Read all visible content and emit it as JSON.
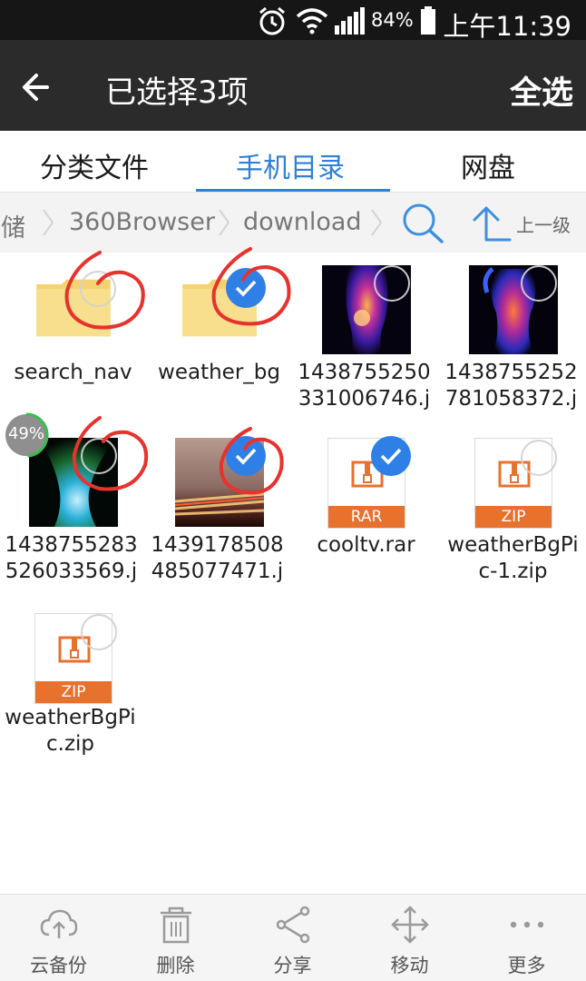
{
  "status_bar": {
    "battery_percent": "84%",
    "time": "上午11:39",
    "icons": [
      "alarm-icon",
      "wifi-icon",
      "signal-icon",
      "battery-icon"
    ]
  },
  "header": {
    "title": "已选择3项",
    "select_all": "全选",
    "back_icon": "back-arrow-icon"
  },
  "tabs": [
    {
      "label": "分类文件",
      "active": false
    },
    {
      "label": "手机目录",
      "active": true
    },
    {
      "label": "网盘",
      "active": false
    }
  ],
  "breadcrumb": {
    "items": [
      "存储",
      "360Browser",
      "download"
    ],
    "up_label": "上一级",
    "search_icon": "search-icon",
    "up_icon": "up-arrow-icon"
  },
  "files": [
    {
      "name": "search_nav",
      "type": "folder",
      "selected": false
    },
    {
      "name": "weather_bg",
      "type": "folder",
      "selected": true
    },
    {
      "name": "1438755250331006746.j",
      "line1": "1438755250",
      "line2": "331006746.j",
      "type": "image",
      "selected": false
    },
    {
      "name": "1438755252781058372.j",
      "line1": "1438755252",
      "line2": "781058372.j",
      "type": "image",
      "selected": false
    },
    {
      "name": "1438755283526033569.j",
      "line1": "1438755283",
      "line2": "526033569.j",
      "type": "image",
      "selected": false
    },
    {
      "name": "1439178508485077471.j",
      "line1": "1439178508",
      "line2": "485077471.j",
      "type": "image",
      "selected": true
    },
    {
      "name": "cooltv.rar",
      "type": "archive",
      "badge": "RAR",
      "selected": true
    },
    {
      "name": "weatherBgPic-1.zip",
      "line1": "weatherBgPi",
      "line2": "c-1.zip",
      "type": "archive",
      "badge": "ZIP",
      "selected": false
    },
    {
      "name": "weatherBgPic.zip",
      "line1": "weatherBgPi",
      "line2": "c.zip",
      "type": "archive",
      "badge": "ZIP",
      "selected": false
    }
  ],
  "progress": {
    "label": "49%",
    "value": 0.49
  },
  "toolbar": [
    {
      "label": "云备份",
      "icon": "cloud-upload-icon"
    },
    {
      "label": "删除",
      "icon": "trash-icon"
    },
    {
      "label": "分享",
      "icon": "share-icon"
    },
    {
      "label": "移动",
      "icon": "move-icon"
    },
    {
      "label": "更多",
      "icon": "more-icon"
    }
  ],
  "colors": {
    "accent": "#2f80d6",
    "check": "#2f80e6",
    "archive_badge": "#e8712e",
    "annotation": "#e8322d",
    "folder": "#f7dc8a"
  }
}
